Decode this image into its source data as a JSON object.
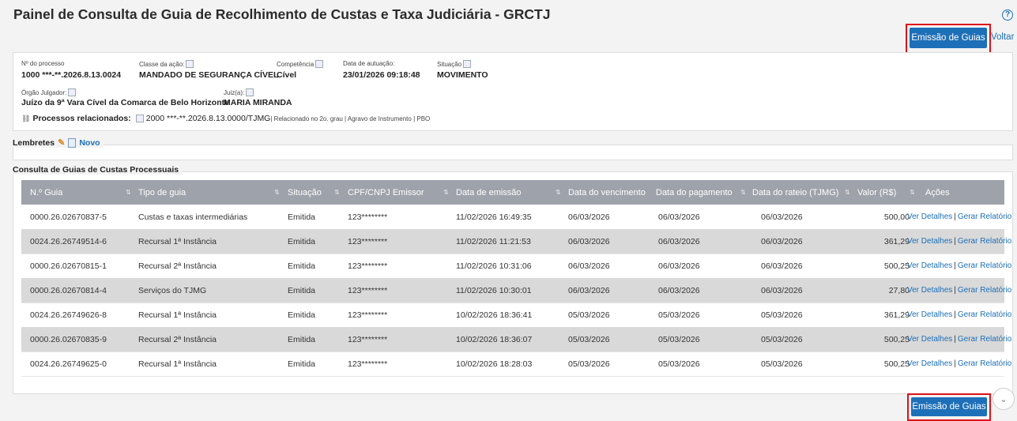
{
  "page": {
    "title": "Painel de Consulta de Guia de Recolhimento de Custas e Taxa Judiciária - GRCTJ",
    "help_icon": "question-circle-icon"
  },
  "actions": {
    "emit_label": "Emissão de Guias",
    "back_label": "Voltar"
  },
  "process": {
    "numero": {
      "label": "Nº do processo",
      "value": "1000 ***-**.2026.8.13.0024"
    },
    "classe": {
      "label": "Classe da ação:",
      "value": "MANDADO DE SEGURANÇA CÍVEL"
    },
    "competencia": {
      "label": "Competência",
      "value": "Cível"
    },
    "autuacao": {
      "label": "Data de autuação:",
      "value": "23/01/2026 09:18:48"
    },
    "situacao": {
      "label": "Situação",
      "value": "MOVIMENTO"
    },
    "orgao": {
      "label": "Órgão Julgador:",
      "value": "Juízo da 9ª Vara Cível da Comarca de Belo Horizonte"
    },
    "juiz": {
      "label": "Juiz(a):",
      "value": "MARIA MIRANDA"
    },
    "relacionados": {
      "label": "Processos relacionados:",
      "value": "2000 ***-**.2026.8.13.0000/TJMG",
      "detail": "| Relacionado no 2o. grau | Agravo de Instrumento | PBO"
    }
  },
  "lembretes": {
    "label": "Lembretes",
    "novo": "Novo"
  },
  "table": {
    "title": "Consulta de Guias de Custas Processuais",
    "columns": [
      "N.º Guia",
      "Tipo de guia",
      "Situação",
      "CPF/CNPJ Emissor",
      "Data de emissão",
      "Data do vencimento",
      "Data do pagamento",
      "Data do rateio (TJMG)",
      "Valor (R$)",
      "Ações"
    ],
    "action_details": "Ver Detalhes",
    "action_report": "Gerar Relatório",
    "rows": [
      [
        "0000.26.02670837-5",
        "Custas e taxas intermediárias",
        "Emitida",
        "123********",
        "11/02/2026 16:49:35",
        "06/03/2026",
        "06/03/2026",
        "06/03/2026",
        "500,00"
      ],
      [
        "0024.26.26749514-6",
        "Recursal 1ª Instância",
        "Emitida",
        "123********",
        "11/02/2026 11:21:53",
        "06/03/2026",
        "06/03/2026",
        "06/03/2026",
        "361,29"
      ],
      [
        "0000.26.02670815-1",
        "Recursal 2ª Instância",
        "Emitida",
        "123********",
        "11/02/2026 10:31:06",
        "06/03/2026",
        "06/03/2026",
        "06/03/2026",
        "500,25"
      ],
      [
        "0000.26.02670814-4",
        "Serviços do TJMG",
        "Emitida",
        "123********",
        "11/02/2026 10:30:01",
        "06/03/2026",
        "06/03/2026",
        "06/03/2026",
        "27,80"
      ],
      [
        "0024.26.26749626-8",
        "Recursal 1ª Instância",
        "Emitida",
        "123********",
        "10/02/2026 18:36:41",
        "05/03/2026",
        "05/03/2026",
        "05/03/2026",
        "361,29"
      ],
      [
        "0000.26.02670835-9",
        "Recursal 2ª Instância",
        "Emitida",
        "123********",
        "10/02/2026 18:36:07",
        "05/03/2026",
        "05/03/2026",
        "05/03/2026",
        "500,25"
      ],
      [
        "0024.26.26749625-0",
        "Recursal 1ª Instância",
        "Emitida",
        "123********",
        "10/02/2026 18:28:03",
        "05/03/2026",
        "05/03/2026",
        "05/03/2026",
        "500,25"
      ]
    ]
  }
}
